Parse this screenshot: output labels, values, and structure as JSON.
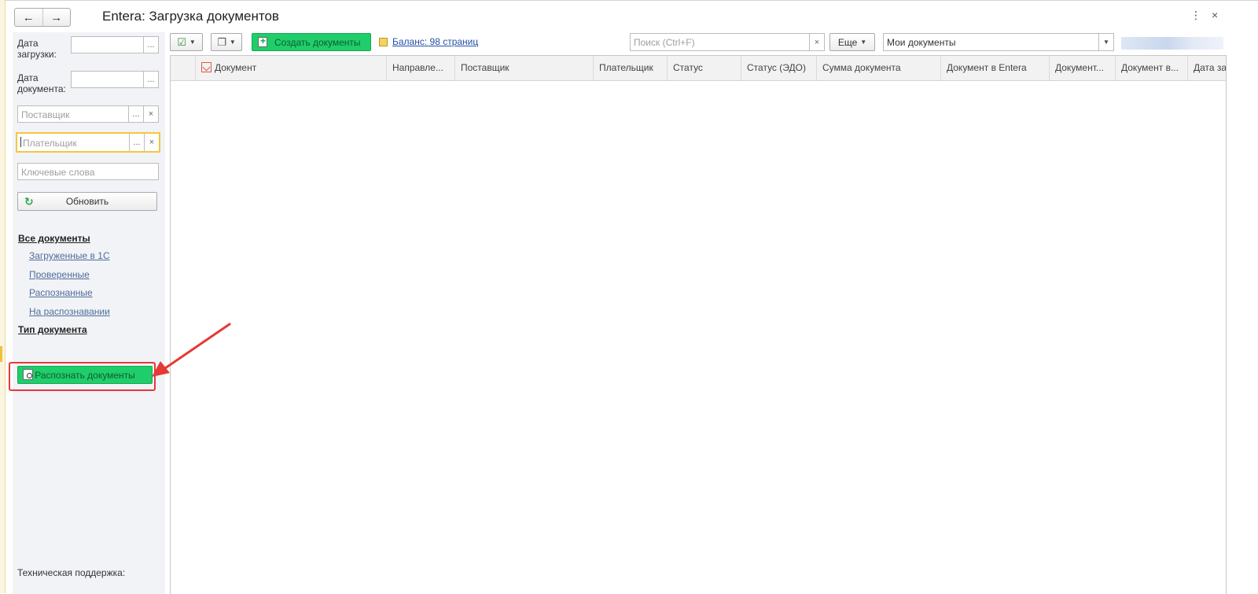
{
  "window": {
    "title": "Entera: Загрузка документов",
    "more_icon": "⋮",
    "close_icon": "×"
  },
  "nav": {
    "back": "←",
    "forward": "→"
  },
  "filters": {
    "upload_date_label": "Дата загрузки:",
    "doc_date_label": "Дата документа:",
    "supplier_placeholder": "Поставщик",
    "payer_placeholder": "Плательщик",
    "keywords_placeholder": "Ключевые слова",
    "picker": "...",
    "clear": "×",
    "refresh": "Обновить"
  },
  "doc_groups": {
    "all": "Все документы",
    "items": [
      "Загруженные в 1С",
      "Проверенные",
      "Распознанные",
      "На распознавании"
    ],
    "type": "Тип документа"
  },
  "recognize_button": "Распознать документы",
  "support_label": "Техническая поддержка:",
  "toolbar": {
    "create": "Создать документы",
    "balance": "Баланс: 98 страниц",
    "search_placeholder": "Поиск (Ctrl+F)",
    "more": "Еще",
    "my_docs": "Мои документы"
  },
  "columns": [
    "Документ",
    "Направле...",
    "Поставщик",
    "Плательщик",
    "Статус",
    "Статус (ЭДО)",
    "Сумма документа",
    "Документ в Entera",
    "Документ...",
    "Документ в...",
    "Дата за"
  ],
  "colors": {
    "accent_green": "#1fce6a",
    "highlight_red": "#e53935",
    "focus_yellow": "#f5c541",
    "link_blue": "#2450a8"
  }
}
